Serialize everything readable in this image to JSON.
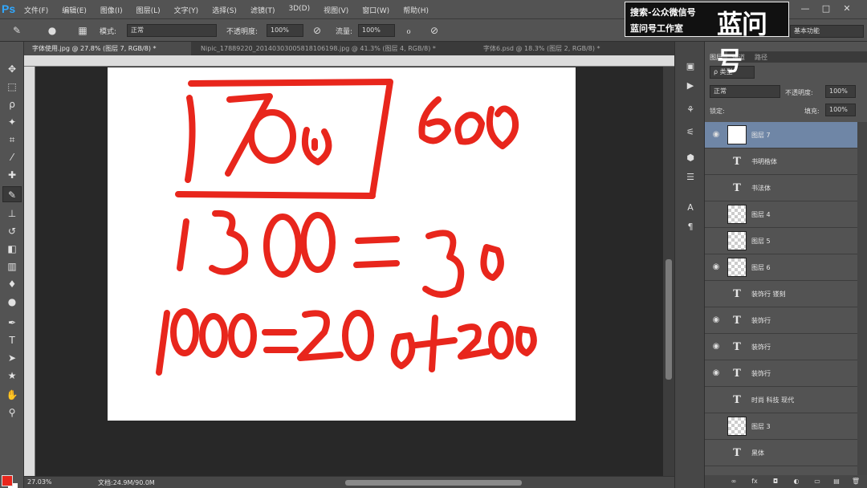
{
  "app": {
    "logo": "Ps"
  },
  "menu": [
    "文件(F)",
    "编辑(E)",
    "图像(I)",
    "图层(L)",
    "文字(Y)",
    "选择(S)",
    "滤镜(T)",
    "3D(D)",
    "视图(V)",
    "窗口(W)",
    "帮助(H)"
  ],
  "watermark": {
    "line1": "搜索-公众微信号",
    "line2": "蓝问号工作室",
    "big": "蓝问号"
  },
  "window_controls": [
    "—",
    "□",
    "✕"
  ],
  "options": {
    "mode_label": "模式:",
    "mode_value": "正常",
    "opacity_label": "不透明度:",
    "opacity_value": "100%",
    "flow_label": "流量:",
    "flow_value": "100%",
    "workspace": "基本功能"
  },
  "tabs": [
    "字体使用.jpg @ 27.8% (图层 7, RGB/8) *",
    "Nipic_17889220_20140303005818106198.jpg @ 41.3% (图层 4, RGB/8) *",
    "字体6.psd @ 18.3% (图层 2, RGB/8) *"
  ],
  "colors": {
    "foreground": "#e8261c",
    "background": "#ffffff",
    "ink": "#e8261c"
  },
  "status": {
    "zoom": "27.03%",
    "doc": "文档:24.9M/90.0M"
  },
  "layers_panel": {
    "tabs": [
      "图层",
      "通道",
      "路径"
    ],
    "filter_label": "ρ 类型",
    "blend_mode": "正常",
    "opacity_label": "不透明度:",
    "opacity_value": "100%",
    "lock_label": "锁定:",
    "fill_label": "填充:",
    "fill_value": "100%",
    "layers": [
      {
        "name": "图层 7",
        "kind": "image",
        "visible": true,
        "selected": true
      },
      {
        "name": "书明楷体",
        "kind": "text",
        "visible": false,
        "selected": false
      },
      {
        "name": "书法体",
        "kind": "text",
        "visible": false,
        "selected": false
      },
      {
        "name": "图层 4",
        "kind": "image",
        "visible": false,
        "selected": false
      },
      {
        "name": "图层 5",
        "kind": "image",
        "visible": false,
        "selected": false
      },
      {
        "name": "图层 6",
        "kind": "image",
        "visible": true,
        "selected": false
      },
      {
        "name": "装饰行 镂刻",
        "kind": "text",
        "visible": false,
        "selected": false
      },
      {
        "name": "装饰行",
        "kind": "text",
        "visible": true,
        "selected": false
      },
      {
        "name": "装饰行",
        "kind": "text",
        "visible": true,
        "selected": false
      },
      {
        "name": "装饰行",
        "kind": "text",
        "visible": true,
        "selected": false
      },
      {
        "name": "时尚 科技 现代",
        "kind": "text",
        "visible": false,
        "selected": false
      },
      {
        "name": "图层 3",
        "kind": "image",
        "visible": false,
        "selected": false
      },
      {
        "name": "黑体",
        "kind": "text",
        "visible": false,
        "selected": false
      }
    ]
  },
  "canvas_text": {
    "line1_boxed": "700",
    "line1_side": "600",
    "line2": "1300=30",
    "line3": "1000=200+200"
  }
}
